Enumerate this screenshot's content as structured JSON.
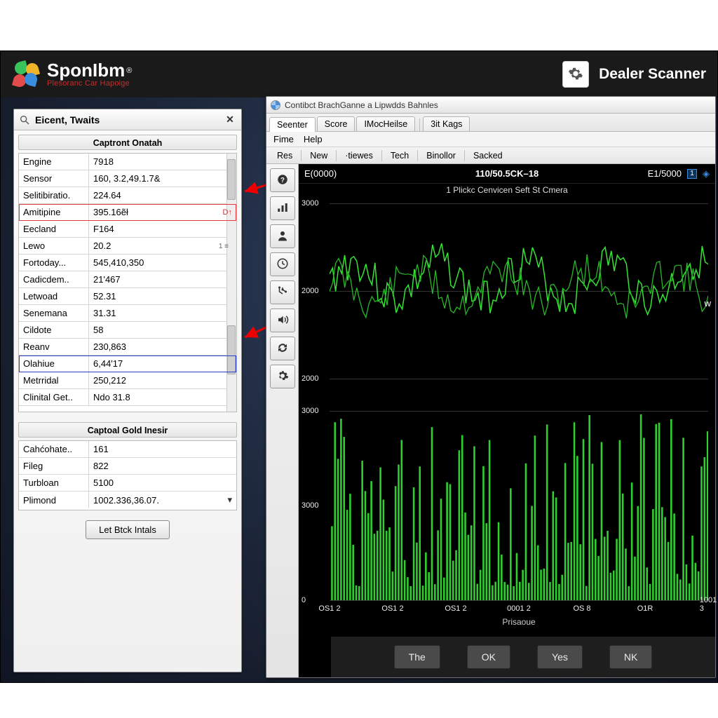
{
  "header": {
    "brand": "SponIbm",
    "trademark": "®",
    "tagline": "Plesoranc Car Hapoige",
    "scanner_label": "Dealer  Scanner"
  },
  "sidebar": {
    "title": "Eicent, Twaits",
    "section1_header": "Captront Onatah",
    "section2_header": "Captoal Gold Inesir",
    "badge_text": "1 ≡",
    "rows1": [
      {
        "label": "Engine",
        "value": "7918"
      },
      {
        "label": "Sensor",
        "value": "160, 3.2,49.1.7&"
      },
      {
        "label": "Selitibiratio.",
        "value": "224.64"
      },
      {
        "label": "Amitipine",
        "value": "395.16ẽł",
        "hl": "red",
        "flag": "D↑"
      },
      {
        "label": "Eecland",
        "value": "F164"
      },
      {
        "label": "Lewo",
        "value": "20.2"
      },
      {
        "label": "Fortoday...",
        "value": "545,410,350"
      },
      {
        "label": "Cadicdem..",
        "value": "21'467"
      },
      {
        "label": "Letwoad",
        "value": "52.31"
      },
      {
        "label": "Senemana",
        "value": "31.31"
      },
      {
        "label": "Cildote",
        "value": "58"
      },
      {
        "label": "Reanv",
        "value": "230,863"
      },
      {
        "label": "Olahiue",
        "value": "6,44'17",
        "hl": "blue"
      },
      {
        "label": "Metrridal",
        "value": "250,212"
      },
      {
        "label": "Clinital Get..",
        "value": "Ndo 31.8"
      }
    ],
    "rows2": [
      {
        "label": "Cahćohate..",
        "value": "161"
      },
      {
        "label": "Fileg",
        "value": "822"
      },
      {
        "label": "Turbloan",
        "value": "5100"
      },
      {
        "label": "Plimond",
        "value": "1002.336,36.07.",
        "dd": true
      }
    ],
    "button_label": "Let Btck Intals"
  },
  "content": {
    "window_title": "Contibct BrachGanne a Lipwdds Bahnles",
    "tabs": [
      "Seenter",
      "Score",
      "IMocHeilse",
      "3it Kags"
    ],
    "active_tab": 0,
    "menu": [
      "Fime",
      "Help"
    ],
    "toolbar": [
      "Res",
      "New",
      "·tiewes",
      "Tech",
      "Binollor",
      "Sacked"
    ],
    "status_left": "E(0000)",
    "status_mid": "110/50.5CK–18",
    "status_right": "E1/5000",
    "subcaption": "1 Plickc Cenvicen Seft St Cmera",
    "w_label": "w",
    "x_caption": "Prisaoue",
    "footer_buttons": [
      "The",
      "OK",
      "Yes",
      "NK"
    ]
  },
  "side_tools": [
    "help-icon",
    "signal-icon",
    "user-icon",
    "clock-icon",
    "branch-icon",
    "volume-icon",
    "cycle-icon",
    "gear-icon"
  ],
  "chart_data": [
    {
      "type": "line",
      "title": "1 Plickc Cenvicen Seft St Cmera",
      "yticks": [
        3000,
        2000,
        2000
      ],
      "series": [
        {
          "name": "trace-a",
          "color": "#36e236"
        },
        {
          "name": "trace-b",
          "color": "#28b828"
        }
      ],
      "note": "Two overlapping noisy green waveforms oscillating roughly between 1700 and 2400 on a 0–3000 scale; no explicit x values labeled on this pane."
    },
    {
      "type": "bar",
      "yticks": [
        3000,
        3000,
        0
      ],
      "categories": [
        "OS1 2",
        "OS1 2",
        "OS1 2",
        "0001 2",
        "OS 8",
        "O1R",
        "1001 3"
      ],
      "note": "Dense green vertical bars of varying heights from 0 up to ~3000; individual bar values not labeled.",
      "xcap": "Prisaoue"
    }
  ]
}
